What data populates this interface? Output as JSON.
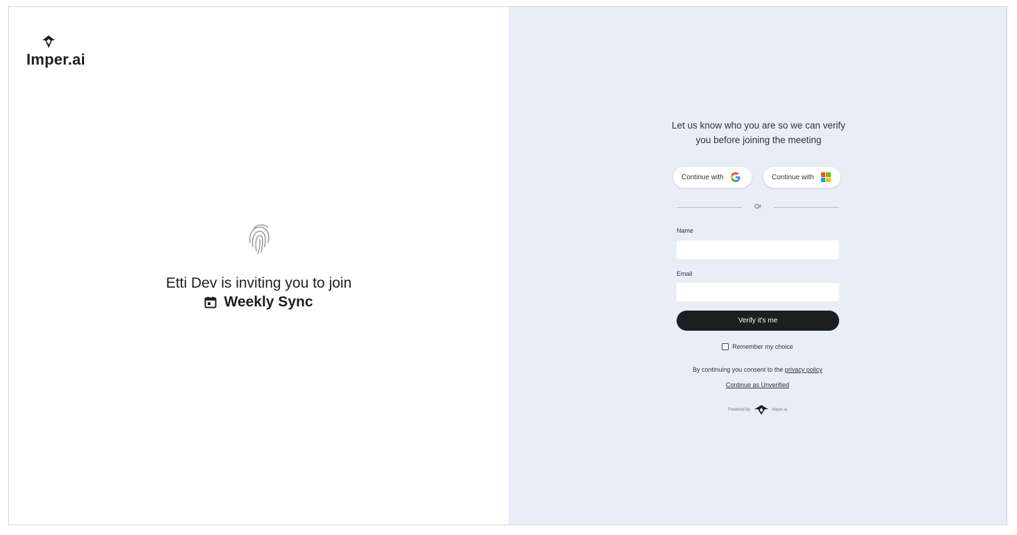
{
  "brand": {
    "logo_text": "Imper.ai"
  },
  "invite": {
    "line": "Etti Dev is inviting you to join",
    "meeting_name": "Weekly Sync"
  },
  "form": {
    "intro": "Let us know who you are so we can verify you before joining the meeting",
    "google_button_label": "Continue with",
    "microsoft_button_label": "Continue with",
    "divider_text": "Or",
    "name_label": "Name",
    "name_value": "",
    "email_label": "Email",
    "email_value": "",
    "verify_button_label": "Verify it's me",
    "remember_label": "Remember my choice",
    "remember_checked": false,
    "consent_prefix": "By continuing you consent to the",
    "privacy_link": "privacy policy",
    "unverified_link": "Continue as Unverified",
    "powered_by_prefix": "Powered by",
    "powered_by_brand": "Imper.ai"
  },
  "colors": {
    "right_panel_bg": "#e9edf6",
    "primary_button": "#1d1e22",
    "google_blue": "#4285F4",
    "google_red": "#EA4335",
    "google_yellow": "#FBBC05",
    "google_green": "#34A853",
    "ms_red": "#F25022",
    "ms_green": "#7FBA00",
    "ms_blue": "#00A4EF",
    "ms_yellow": "#FFB900"
  },
  "icons": {
    "logo": "shield-mask-icon",
    "fingerprint": "fingerprint-icon",
    "calendar": "calendar-icon",
    "google": "google-icon",
    "microsoft": "microsoft-icon"
  }
}
